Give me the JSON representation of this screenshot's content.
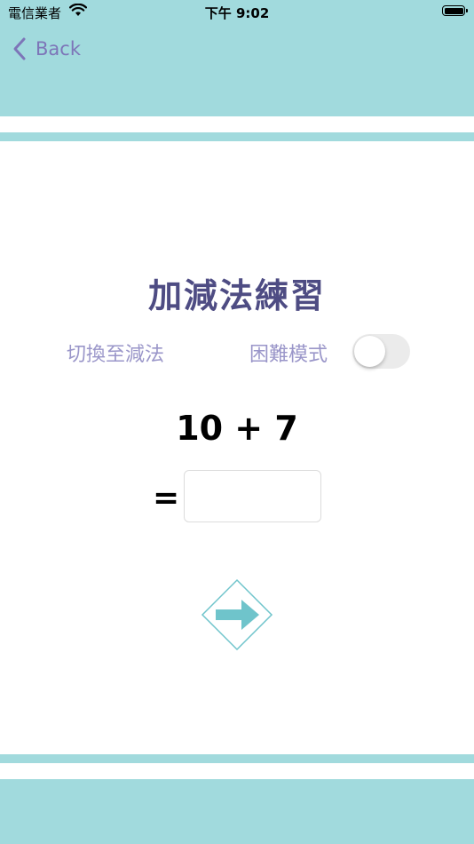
{
  "status_bar": {
    "carrier": "電信業者",
    "time": "下午 9:02"
  },
  "nav": {
    "back_label": "Back"
  },
  "main": {
    "title": "加減法練習",
    "switch_mode_label": "切換至減法",
    "hard_mode_label": "困難模式",
    "hard_mode_on": false,
    "equation": "10 + 7",
    "equals": "=",
    "answer_value": ""
  },
  "colors": {
    "header_bg": "#a1dadd",
    "title": "#4e4c83",
    "label": "#9a96c9",
    "back": "#7d75b8",
    "arrow": "#6fc4cb"
  },
  "icons": {
    "back": "chevron-left-icon",
    "wifi": "wifi-icon",
    "battery": "battery-icon",
    "next": "arrow-right-icon"
  }
}
